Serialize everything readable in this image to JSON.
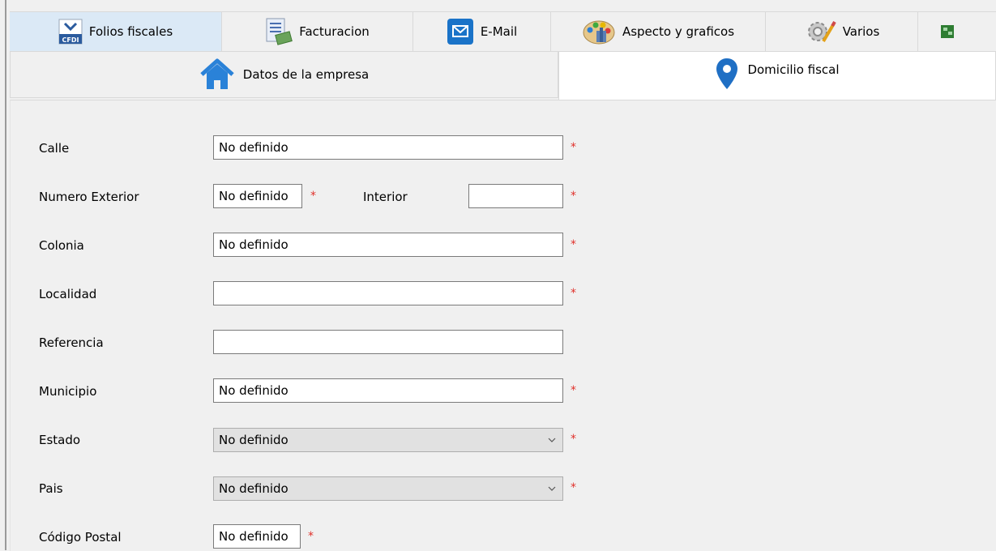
{
  "top_tabs": [
    {
      "label": "Folios fiscales",
      "icon": "cfdi-icon",
      "selected": true
    },
    {
      "label": "Facturacion",
      "icon": "invoice-icon",
      "selected": false
    },
    {
      "label": "E-Mail",
      "icon": "email-icon",
      "selected": false
    },
    {
      "label": "Aspecto y graficos",
      "icon": "palette-icon",
      "selected": false
    },
    {
      "label": "Varios",
      "icon": "gear-icon",
      "selected": false
    }
  ],
  "cfdi_icon_text": "CFDI",
  "sub_tabs": [
    {
      "label": "Datos de la empresa",
      "icon": "home-icon",
      "active": false
    },
    {
      "label": "Domicilio fiscal",
      "icon": "location-pin-icon",
      "active": true
    }
  ],
  "form": {
    "calle": {
      "label": "Calle",
      "value": "No definido",
      "required": true
    },
    "numero_exterior": {
      "label": "Numero Exterior",
      "value": "No definido",
      "required": true
    },
    "interior": {
      "label": "Interior",
      "value": "",
      "required": true
    },
    "colonia": {
      "label": "Colonia",
      "value": "No definido",
      "required": true
    },
    "localidad": {
      "label": "Localidad",
      "value": "",
      "required": true
    },
    "referencia": {
      "label": "Referencia",
      "value": "",
      "required": false
    },
    "municipio": {
      "label": "Municipio",
      "value": "No definido",
      "required": true
    },
    "estado": {
      "label": "Estado",
      "value": "No definido",
      "required": true
    },
    "pais": {
      "label": "Pais",
      "value": "No definido",
      "required": true
    },
    "codigo_postal": {
      "label": "Código Postal",
      "value": "No definido",
      "required": true
    }
  },
  "required_marker": "*",
  "colors": {
    "required": "#e0302a",
    "selected_tab": "#dbe9f6",
    "email_icon": "#1a73c8",
    "pin_icon": "#1f6fc4"
  }
}
